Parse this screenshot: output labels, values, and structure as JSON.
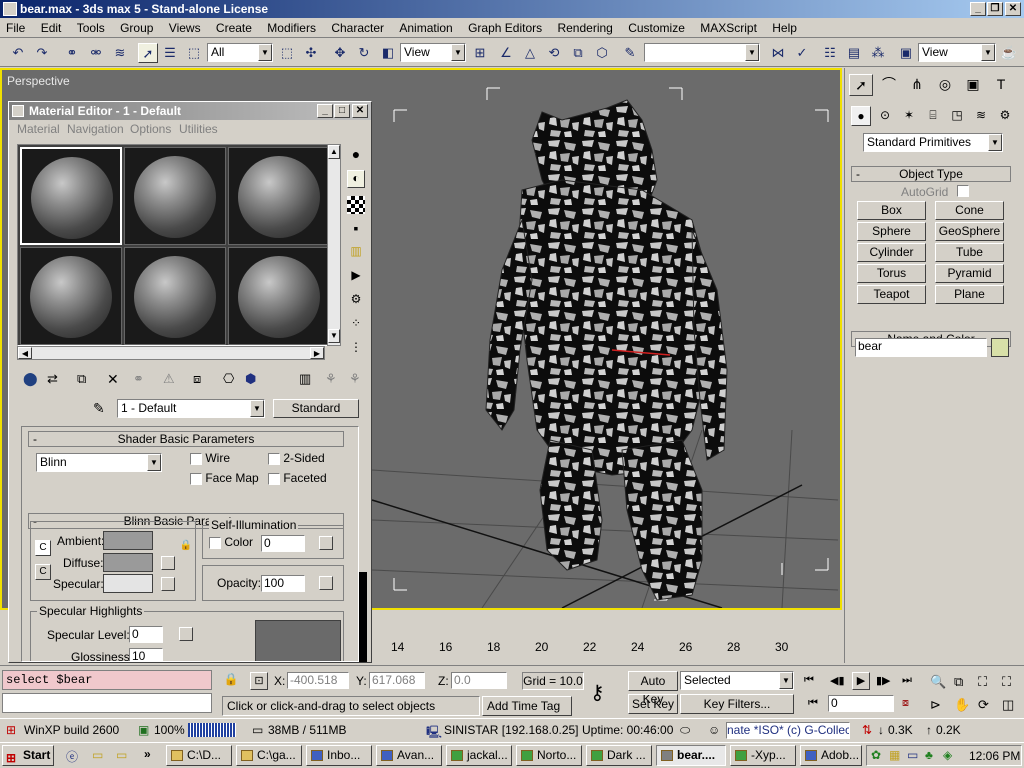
{
  "window": {
    "title": "bear.max - 3ds max 5 - Stand-alone License"
  },
  "menu": [
    "File",
    "Edit",
    "Tools",
    "Group",
    "Views",
    "Create",
    "Modifiers",
    "Character",
    "Animation",
    "Graph Editors",
    "Rendering",
    "Customize",
    "MAXScript",
    "Help"
  ],
  "toolbar": {
    "selection_filter": "All",
    "ref_coord": "View",
    "named_sel": "",
    "view_right": "View"
  },
  "viewport": {
    "label": "Perspective"
  },
  "command_panel": {
    "category": "Standard Primitives",
    "object_type_title": "Object Type",
    "autogrid_label": "AutoGrid",
    "buttons": [
      "Box",
      "Cone",
      "Sphere",
      "GeoSphere",
      "Cylinder",
      "Tube",
      "Torus",
      "Pyramid",
      "Teapot",
      "Plane"
    ],
    "name_color_title": "Name and Color",
    "object_name": "bear",
    "object_color": "#d8e0a8"
  },
  "material_editor": {
    "title": "Material Editor - 1 - Default",
    "menus": [
      "Material",
      "Navigation",
      "Options",
      "Utilities"
    ],
    "material_name": "1 - Default",
    "material_type": "Standard",
    "shader_title": "Shader Basic Parameters",
    "shader": "Blinn",
    "wire": "Wire",
    "two_sided": "2-Sided",
    "face_map": "Face Map",
    "faceted": "Faceted",
    "blinn_title": "Blinn Basic Parameters",
    "self_illum_title": "Self-Illumination",
    "color_label": "Color",
    "self_illum_value": "0",
    "ambient_label": "Ambient:",
    "diffuse_label": "Diffuse:",
    "specular_label": "Specular:",
    "ambient_color": "#9a9a9a",
    "diffuse_color": "#9a9a9a",
    "specular_color": "#e4e4e4",
    "opacity_label": "Opacity:",
    "opacity_value": "100",
    "spec_highlights_title": "Specular Highlights",
    "spec_level_label": "Specular Level:",
    "spec_level_value": "0",
    "glossiness_label": "Glossiness:",
    "glossiness_value": "10"
  },
  "timeline": {
    "ticks": [
      "14",
      "16",
      "18",
      "20",
      "22",
      "24",
      "26",
      "28",
      "30"
    ]
  },
  "status": {
    "maxscript_line": "select $bear",
    "x_label": "X:",
    "x_value": "-400.518",
    "y_label": "Y:",
    "y_value": "617.068",
    "z_label": "Z:",
    "z_value": "0.0",
    "grid": "Grid = 10.0",
    "prompt": "Click or click-and-drag to select objects",
    "add_time_tag": "Add Time Tag",
    "auto_key": "Auto Key",
    "set_key": "Set Key",
    "key_mode": "Selected",
    "key_filters": "Key Filters...",
    "frame": "0"
  },
  "tray_bar": {
    "items": [
      "WinXP build 2600",
      "100%",
      "38MB / 511MB",
      "SINISTAR [192.168.0.25]",
      "Uptime: 00:46:00"
    ],
    "net_text": "nate *ISO* (c) G-Collect",
    "down": "0.3K",
    "up": "0.2K"
  },
  "taskbar": {
    "start": "Start",
    "tasks": [
      "C:\\D...",
      "C:\\ga...",
      "Inbo...",
      "Avan...",
      "jackal...",
      "Norto...",
      "Dark ...",
      "bear....",
      "-Xyp...",
      "Adob..."
    ],
    "clock": "12:06 PM"
  }
}
